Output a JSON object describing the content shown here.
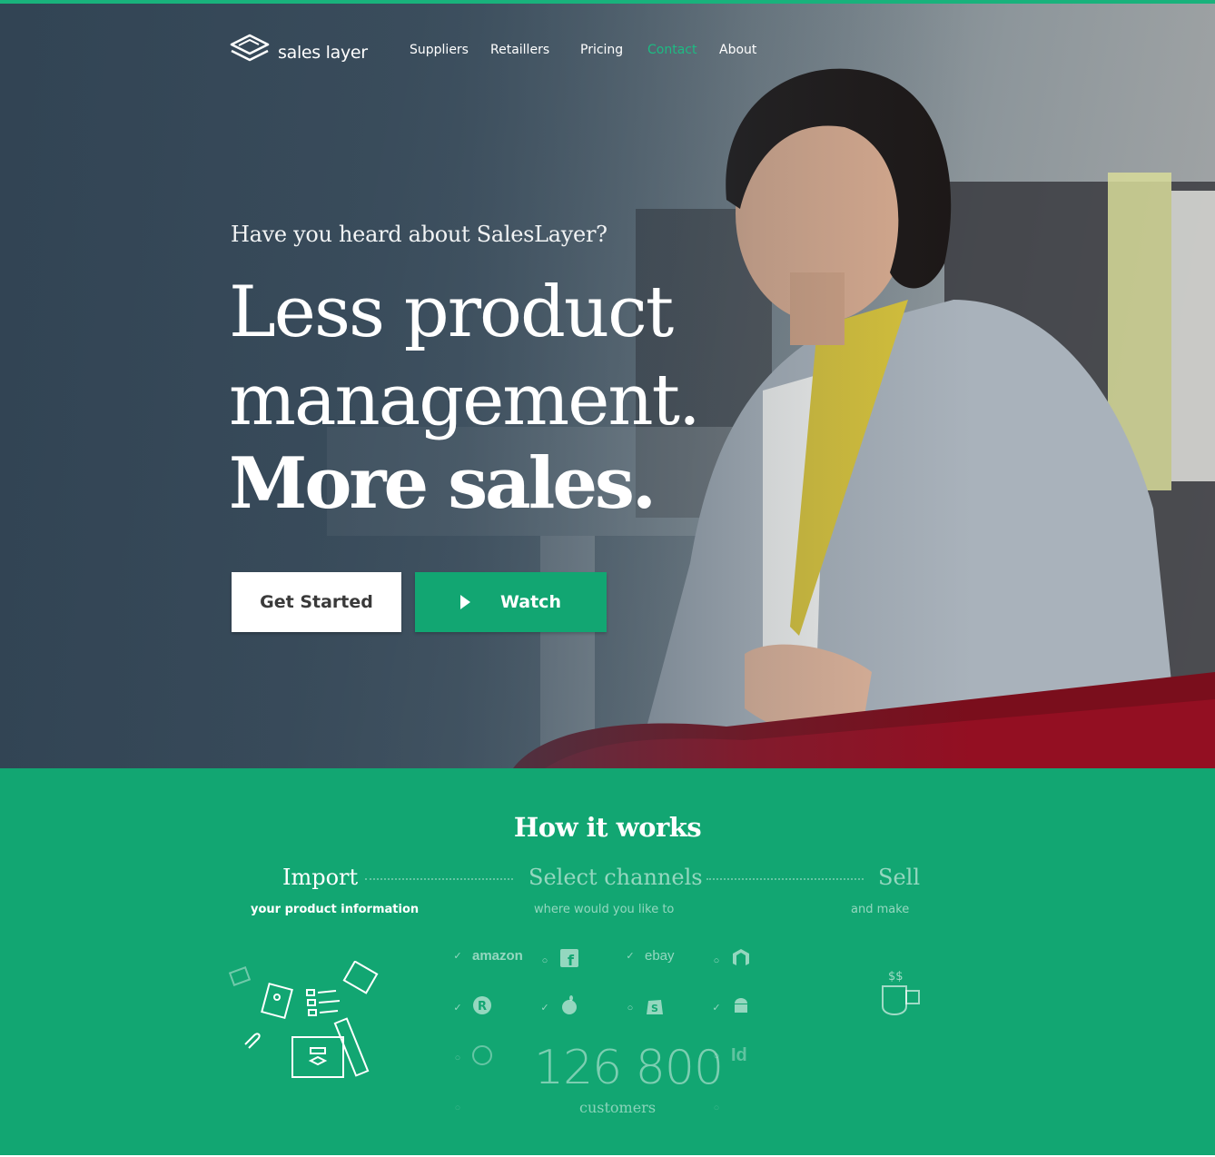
{
  "nav": {
    "logo_text": "sales layer",
    "items": [
      "Suppliers",
      "Retaillers",
      "Pricing",
      "Contact",
      "About"
    ],
    "active": "Contact"
  },
  "hero": {
    "kicker": "Have you heard about SalesLayer?",
    "line1": "Less product",
    "line2": "management.",
    "line3": "More sales.",
    "btn_start": "Get Started",
    "btn_watch": "Watch"
  },
  "how": {
    "title": "How it works",
    "steps": [
      {
        "title": "Import",
        "sub": "your product information"
      },
      {
        "title": "Select channels",
        "sub": "where would you like to"
      },
      {
        "title": "Sell",
        "sub": "and make"
      }
    ],
    "channels": [
      "amazon",
      "ebay"
    ],
    "customers_count": "126 800",
    "customers_label": "customers"
  },
  "colors": {
    "accent": "#12a672",
    "active_nav": "#1dbb83"
  }
}
